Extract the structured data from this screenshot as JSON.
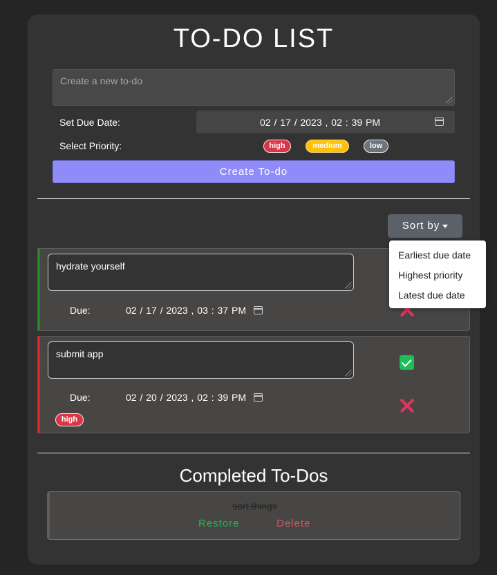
{
  "app": {
    "title": "TO-DO LIST"
  },
  "form": {
    "new_todo_placeholder": "Create a new to-do",
    "due_date_label": "Set Due Date:",
    "due_date_value": "02 / 17 / 2023 ,  02 : 39   PM",
    "priority_label": "Select Priority:",
    "priorities": [
      "high",
      "medium",
      "low"
    ],
    "create_label": "Create To-do"
  },
  "sort": {
    "label": "Sort by",
    "menu": [
      "Earliest due date",
      "Highest priority",
      "Latest due date"
    ]
  },
  "todos": [
    {
      "text": "hydrate yourself",
      "due_label": "Due:",
      "due": "02 / 17 / 2023 ,  03 : 37   PM",
      "priority": "",
      "accent": "#1f8a1f"
    },
    {
      "text": "submit app",
      "due_label": "Due:",
      "due": "02 / 20 / 2023 ,  02 : 39   PM",
      "priority": "high",
      "accent": "#dc2626"
    }
  ],
  "completed": {
    "title": "Completed To-Dos",
    "items": [
      {
        "text": "sort things",
        "restore_label": "Restore",
        "delete_label": "Delete"
      }
    ]
  },
  "colors": {
    "primary": "#8f8cfa",
    "high": "#dc3545",
    "medium": "#ffc107",
    "low": "#6c757d",
    "done": "#1bbf5a",
    "delete": "#e8315f"
  }
}
